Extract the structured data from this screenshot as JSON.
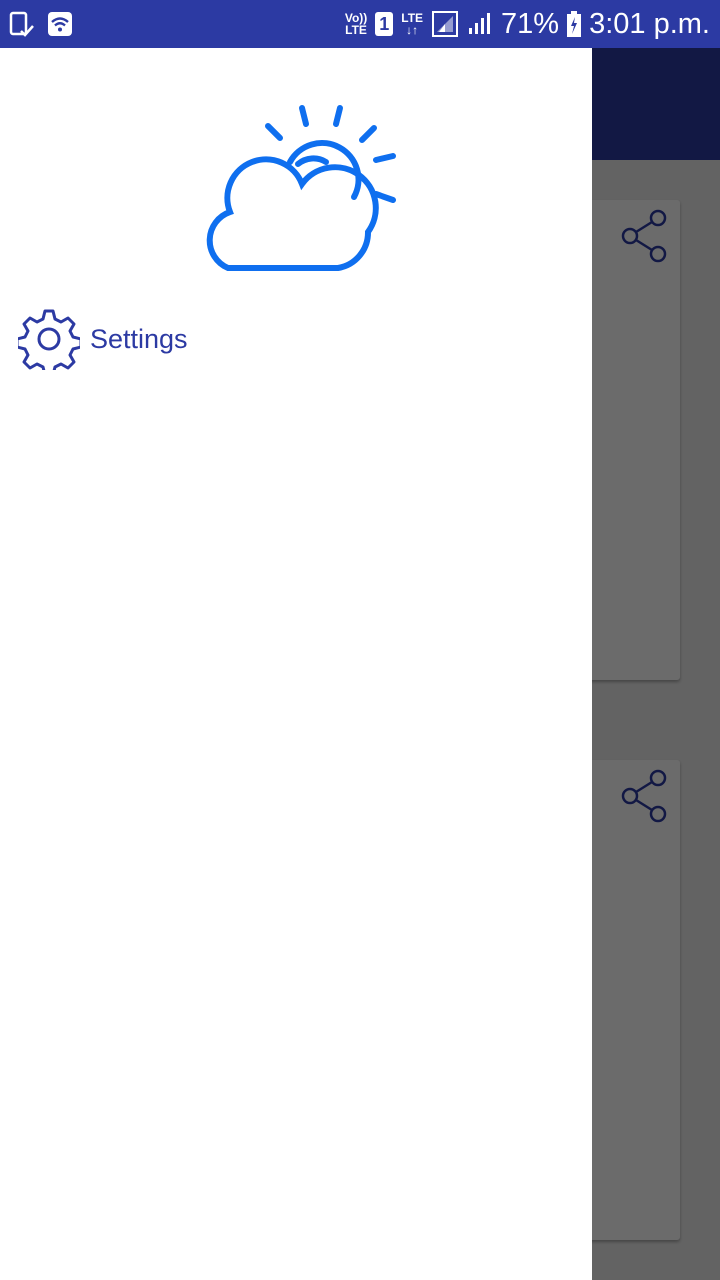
{
  "status_bar": {
    "volte_label": "Vo))\nLTE",
    "sim_label": "1",
    "lte_label": "LTE",
    "battery_percent": "71%",
    "time": "3:01 p.m.",
    "color": "#2c3aa3"
  },
  "drawer": {
    "logo_icon": "cloud-sun-icon",
    "items": [
      {
        "label": "Settings",
        "icon": "gear-icon"
      }
    ]
  },
  "colors": {
    "accent": "#2c3aa3",
    "logo_blue": "#0f6fef",
    "scrim": "rgba(0,0,0,0.58)"
  }
}
